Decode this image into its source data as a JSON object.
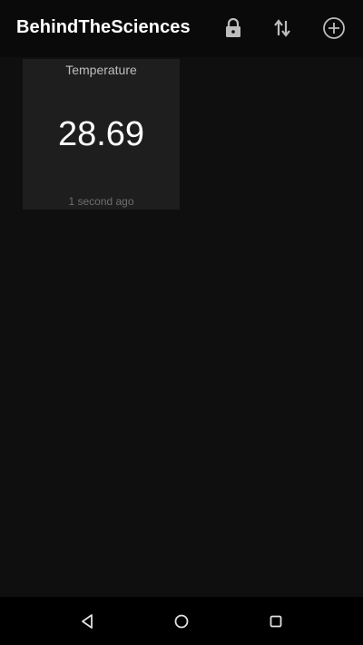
{
  "app_bar": {
    "title": "BehindTheSciences",
    "icons": [
      "lock-icon",
      "sort-icon",
      "add-circle-icon"
    ]
  },
  "tiles": [
    {
      "label": "Temperature",
      "value": "28.69",
      "updated": "1 second ago"
    }
  ],
  "nav_bar": {
    "icons": [
      "back-icon",
      "home-icon",
      "recents-icon"
    ]
  },
  "colors": {
    "background": "#0f0f0f",
    "app_bar": "#0a0a0a",
    "tile": "#1e1e1e",
    "text_primary": "#ffffff",
    "text_secondary": "#bdbdbd"
  }
}
